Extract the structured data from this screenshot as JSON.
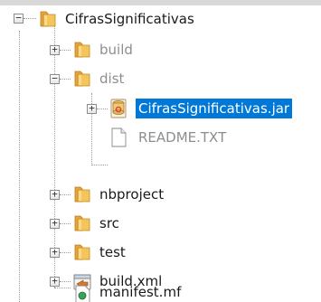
{
  "tree": {
    "project": {
      "label": "CifrasSignificativas",
      "toggle": "−"
    },
    "build": {
      "label": "build",
      "toggle": "+"
    },
    "dist": {
      "label": "dist",
      "toggle": "−"
    },
    "jar": {
      "label": "CifrasSignificativas.jar",
      "toggle": "+"
    },
    "readme": {
      "label": "README.TXT"
    },
    "nbproject": {
      "label": "nbproject",
      "toggle": "+"
    },
    "src": {
      "label": "src",
      "toggle": "+"
    },
    "test": {
      "label": "test",
      "toggle": "+"
    },
    "buildxml": {
      "label": "build.xml",
      "toggle": "+"
    },
    "manifest": {
      "label": "manifest.mf"
    }
  },
  "colors": {
    "selection": "#0078d7",
    "folder": "#f2b544",
    "dim_text": "#8e8e8e"
  }
}
